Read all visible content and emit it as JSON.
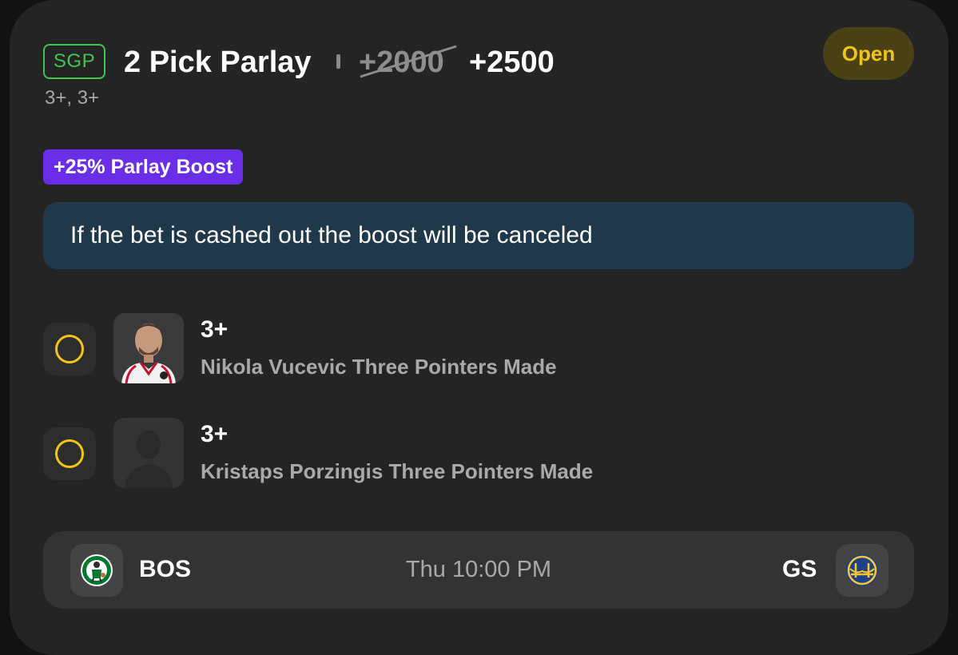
{
  "bet": {
    "type_badge": "SGP",
    "title": "2 Pick Parlay",
    "original_odds": "+2000",
    "boosted_odds": "+2500",
    "status": "Open",
    "summary": "3+, 3+",
    "boost_label": "+25% Parlay Boost",
    "notice": "If the bet is cashed out the boost will be canceled"
  },
  "legs": [
    {
      "line": "3+",
      "market": "Nikola Vucevic Three Pointers Made"
    },
    {
      "line": "3+",
      "market": "Kristaps Porzingis Three Pointers Made"
    }
  ],
  "game": {
    "home_team": "BOS",
    "away_team": "GS",
    "time": "Thu 10:00 PM"
  },
  "colors": {
    "sgp_green": "#3fc54f",
    "open_yellow": "#f2c41a",
    "boost_purple": "#6a2ee8",
    "notice_bg": "#20394a"
  }
}
